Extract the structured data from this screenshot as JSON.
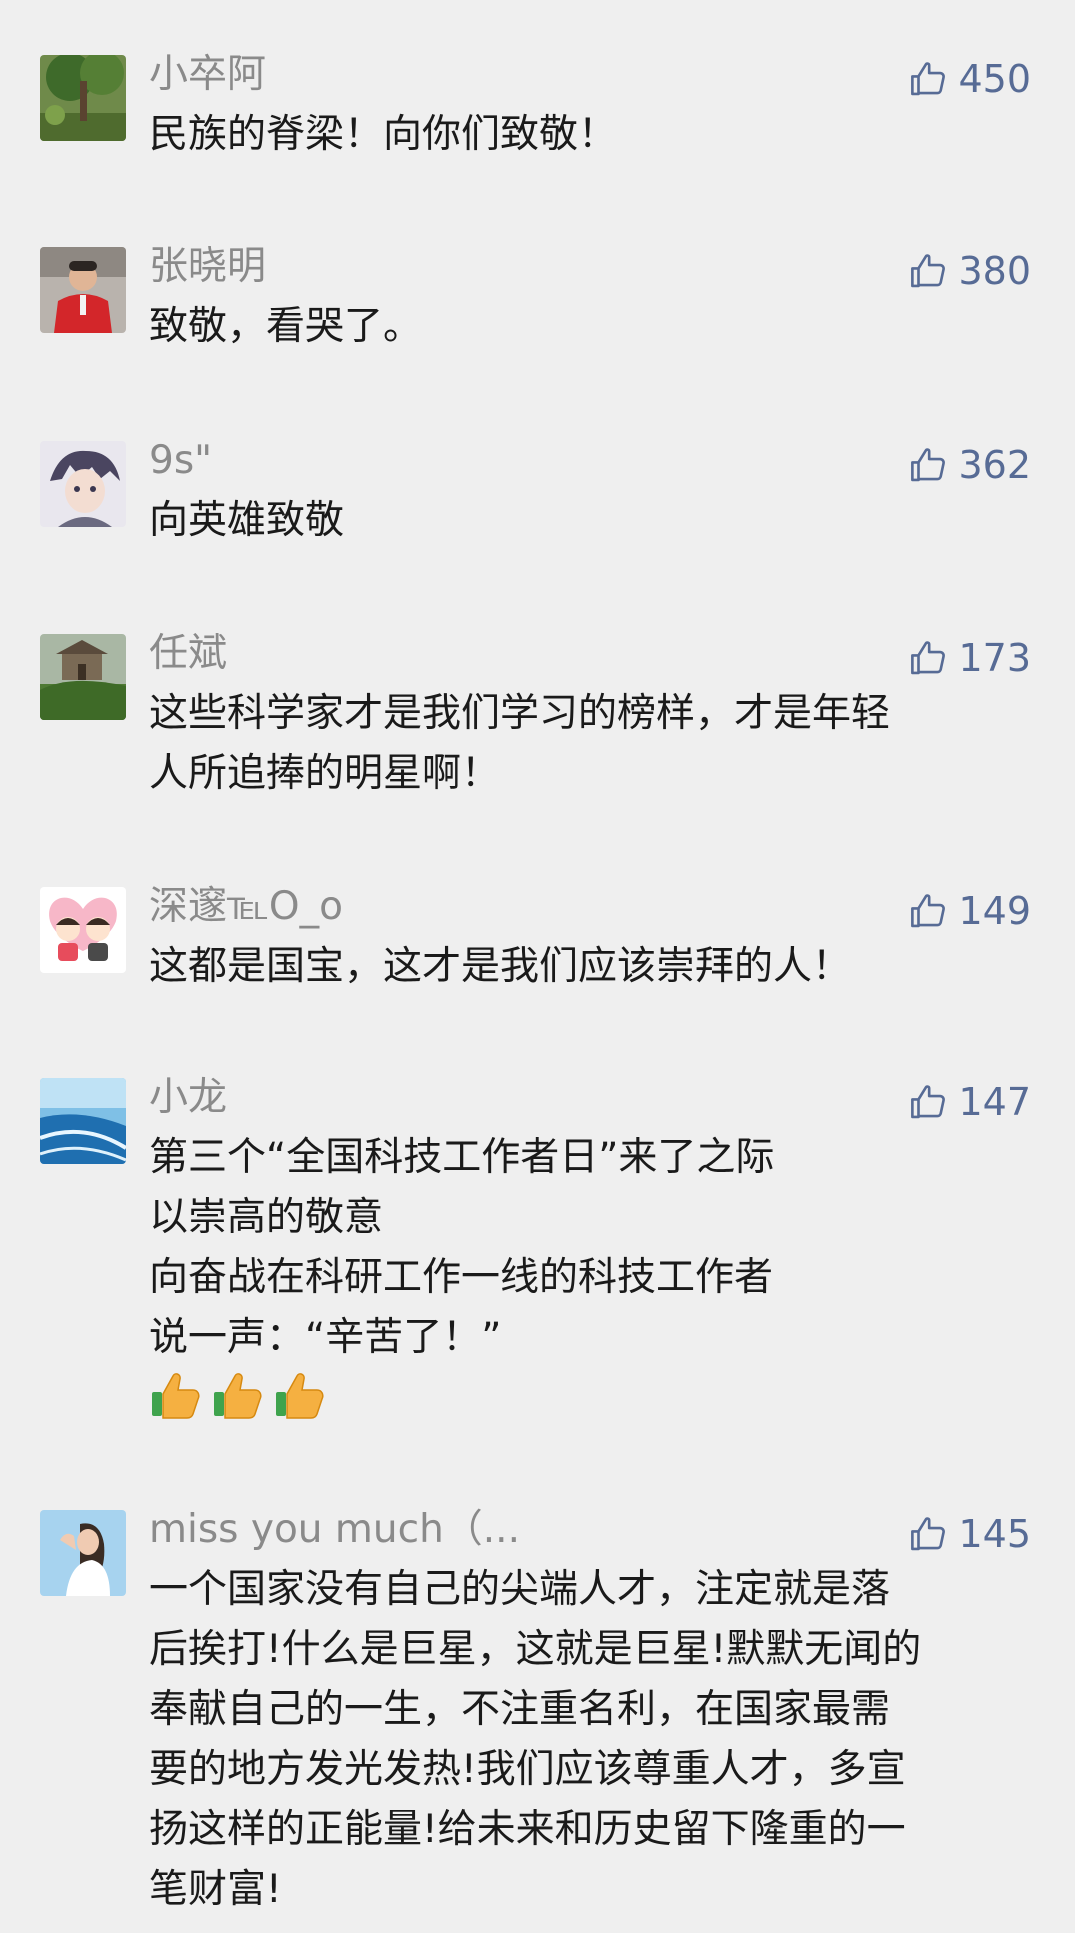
{
  "comments": [
    {
      "name": "小卒阿",
      "likes": "450",
      "text": "民族的脊梁！向你们致敬！",
      "avatar": "tree-photo-avatar"
    },
    {
      "name": "张晓明",
      "likes": "380",
      "text": "致敬，看哭了。",
      "avatar": "man-red-jacket-avatar"
    },
    {
      "name": "9s\"",
      "likes": "362",
      "text": "向英雄致敬",
      "avatar": "anime-character-avatar"
    },
    {
      "name": "任斌",
      "likes": "173",
      "text": "这些科学家才是我们学习的榜样，才是年轻\n人所追捧的明星啊！",
      "avatar": "building-landscape-avatar"
    },
    {
      "name": "深邃℡O_o",
      "likes": "149",
      "text": "这都是国宝，这才是我们应该崇拜的人！",
      "avatar": "cartoon-couple-avatar"
    },
    {
      "name": "小龙",
      "likes": "147",
      "text": "第三个“全国科技工作者日”来了之际\n以崇高的敬意\n向奋战在科研工作一线的科技工作者\n说一声：“辛苦了！”",
      "avatar": "coastline-avatar",
      "emojis": [
        "thumbs-up-emoji",
        "thumbs-up-emoji",
        "thumbs-up-emoji"
      ]
    },
    {
      "name": "miss you much（...",
      "likes": "145",
      "text": "一个国家没有自己的尖端人才，注定就是落\n后挨打!什么是巨星，这就是巨星!默默无闻的\n奉献自己的一生，不注重名利，在国家最需\n要的地方发光发热!我们应该尊重人才，多宣\n扬这样的正能量!给未来和历史留下隆重的一\n笔财富!",
      "avatar": "girl-photo-avatar"
    }
  ],
  "colors": {
    "background": "#efefef",
    "name": "#8a8a8a",
    "likes": "#576b95",
    "text": "#1a1a1a"
  },
  "icons": {
    "like": "thumbs-up-outline-icon"
  }
}
